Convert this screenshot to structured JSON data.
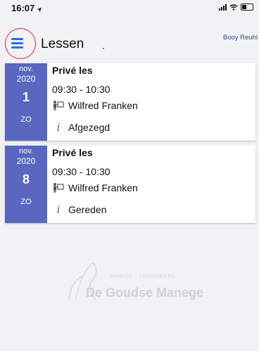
{
  "status_bar": {
    "time": "16:07",
    "location_arrow": "➤"
  },
  "header": {
    "menu_icon": "hamburger-menu-icon",
    "title": "Lessen",
    "user": "Booy Reuhl"
  },
  "lessons": [
    {
      "month": "nov.",
      "year": "2020",
      "day": "1",
      "weekday": "ZO",
      "title": "Privé les",
      "time": "09:30 - 10:30",
      "trainer": "Wilfred Franken",
      "status": "Afgezegd"
    },
    {
      "month": "nov.",
      "year": "2020",
      "day": "8",
      "weekday": "ZO",
      "title": "Privé les",
      "time": "09:30 - 10:30",
      "trainer": "Wilfred Franken",
      "status": "Gereden"
    }
  ],
  "icons": {
    "info": "i",
    "trainer": "instructor-board-icon"
  },
  "watermark": {
    "subtitle": "MANEGE - PENSIONSTAL",
    "name": "De Goudse Manege"
  },
  "colors": {
    "accent": "#5a67c0",
    "menu_icon": "#2f6fd6",
    "highlight_circle": "#d9233a"
  }
}
